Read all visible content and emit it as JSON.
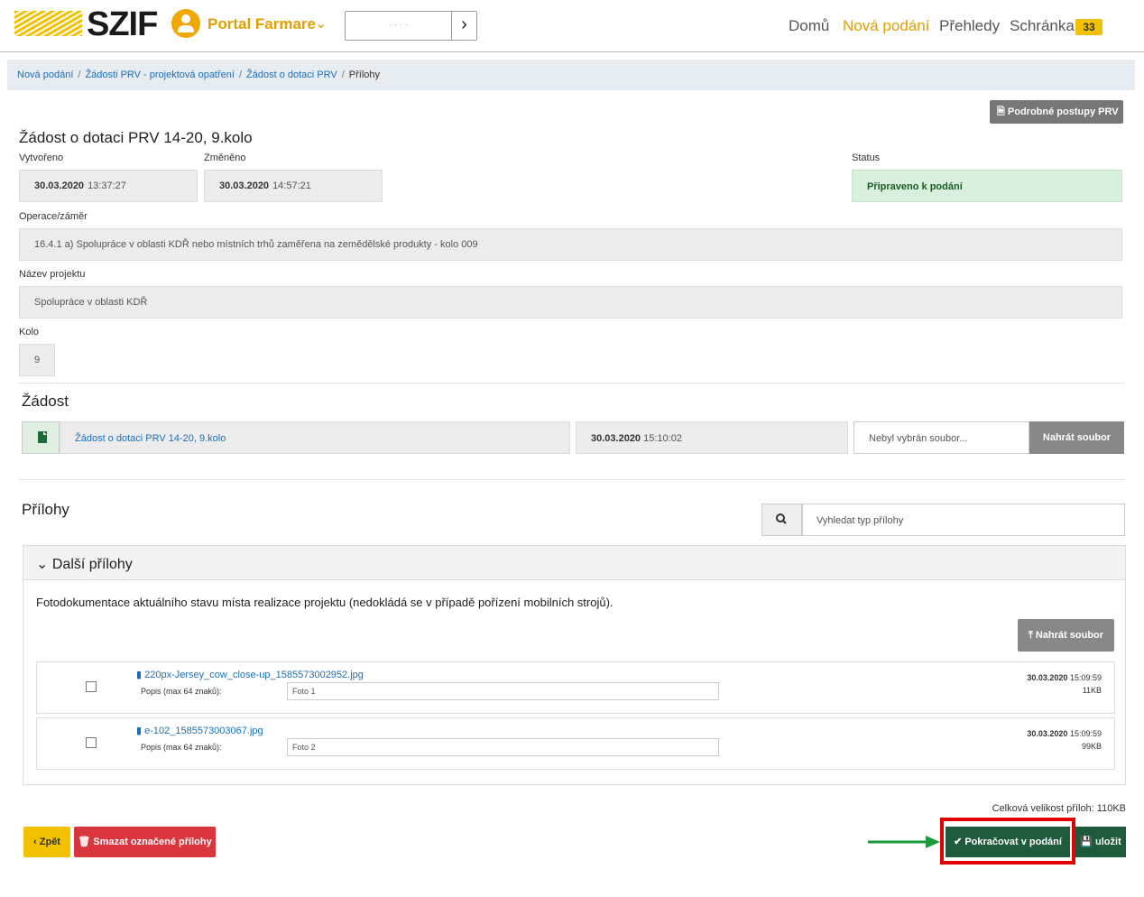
{
  "header": {
    "logo_text": "SZIF",
    "portal_label": "Portal Farmare",
    "subject_placeholder": "· · · ·",
    "nav": [
      {
        "label": "Domů",
        "active": false
      },
      {
        "label": "Nová podání",
        "active": true
      },
      {
        "label": "Přehledy",
        "active": false
      },
      {
        "label": "Schránka",
        "active": false
      }
    ],
    "inbox_count": "33"
  },
  "breadcrumb": {
    "items": [
      "Nová podání",
      "Žádosti PRV - projektová opatření",
      "Žádost o dotaci PRV"
    ],
    "current": "Přílohy"
  },
  "prv_button": "Podrobné postupy PRV",
  "request": {
    "title": "Žádost o dotaci PRV 14-20, 9.kolo",
    "created_label": "Vytvořeno",
    "created_date": "30.03.2020",
    "created_time": "13:37:27",
    "changed_label": "Změněno",
    "changed_date": "30.03.2020",
    "changed_time": "14:57:21",
    "status_label": "Status",
    "status_value": "Připraveno k podání",
    "operation_label": "Operace/záměr",
    "operation_value": "16.4.1 a) Spolupráce v oblasti KDŘ nebo místních trhů zaměřena na zemědělské produkty - kolo 009",
    "project_label": "Název projektu",
    "project_value": "Spolupráce v oblasti KDŘ",
    "round_label": "Kolo",
    "round_value": "9"
  },
  "zadost": {
    "heading": "Žádost",
    "doc_link": "Žádost o dotaci PRV 14-20, 9.kolo",
    "doc_date": "30.03.2020",
    "doc_time": "15:10:02",
    "file_placeholder": "Nebyl vybrán soubor...",
    "upload_label": "Nahrát soubor"
  },
  "attachments": {
    "heading": "Přílohy",
    "search_placeholder": "Vyhledat typ přílohy",
    "panel_title": "Další přílohy",
    "panel_desc": "Fotodokumentace aktuálního stavu místa realizace projektu (nedokládá se v případě pořízení mobilních strojů).",
    "upload_label": "Nahrát soubor",
    "desc_label": "Popis (max 64 znaků):",
    "files": [
      {
        "name": "220px-Jersey_cow_close-up_1585573002952.jpg",
        "desc": "Foto 1",
        "date": "30.03.2020",
        "time": "15:09:59",
        "size": "11KB"
      },
      {
        "name": "e-102_1585573003067.jpg",
        "desc": "Foto 2",
        "date": "30.03.2020",
        "time": "15:09:59",
        "size": "99KB"
      }
    ],
    "total": "Celková velikost příloh: 110KB"
  },
  "footer": {
    "back": "Zpět",
    "delete": "Smazat označené přílohy",
    "continue": "Pokračovat v podání",
    "save": "uložit"
  },
  "colors": {
    "brand_yellow": "#f2c200",
    "link_blue": "#1d6fb8",
    "primary_green": "#1e5a3c",
    "danger_red": "#d9363e",
    "highlight_red": "#e00000",
    "arrow_green": "#1a9a3a"
  }
}
